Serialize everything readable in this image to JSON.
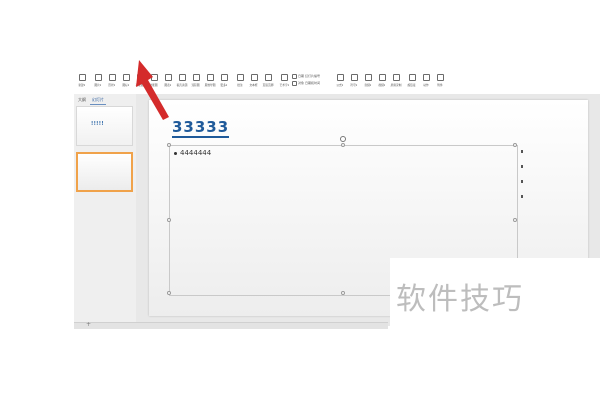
{
  "ribbon": {
    "tools": [
      {
        "name": "tool-1",
        "label": "新建▾"
      },
      {
        "name": "tool-2",
        "label": "图片▾"
      },
      {
        "name": "tool-3",
        "label": "形状▾"
      },
      {
        "name": "tool-4",
        "label": "图标▾"
      },
      {
        "name": "tool-5",
        "label": "功能图"
      },
      {
        "name": "tool-6",
        "label": "智能图"
      },
      {
        "name": "tool-7",
        "label": "图表▾"
      },
      {
        "name": "tool-8",
        "label": "稻壳资源"
      },
      {
        "name": "tool-9",
        "label": "流程图"
      },
      {
        "name": "tool-10",
        "label": "思维导图"
      },
      {
        "name": "tool-11",
        "label": "更多▾"
      },
      {
        "name": "tool-12",
        "label": "批注"
      },
      {
        "name": "tool-13",
        "label": "文本框"
      },
      {
        "name": "tool-14",
        "label": "页眉页脚"
      },
      {
        "name": "tool-15",
        "label": "艺术字▾"
      },
      {
        "name": "tool-16",
        "label": "公式▾"
      },
      {
        "name": "tool-17",
        "label": "符号▾"
      },
      {
        "name": "tool-18",
        "label": "音频▾"
      },
      {
        "name": "tool-19",
        "label": "视频▾"
      },
      {
        "name": "tool-20",
        "label": "屏幕录制"
      },
      {
        "name": "tool-21",
        "label": "超链接"
      },
      {
        "name": "tool-22",
        "label": "动作"
      },
      {
        "name": "tool-23",
        "label": "附件"
      }
    ],
    "wide_tool": {
      "row1": "日期  幻灯片编号",
      "row2": "对象  日期和时间"
    }
  },
  "left_panel": {
    "tabs": [
      "大纲",
      "幻灯片"
    ],
    "thumb1_title": "!!!!!"
  },
  "slide": {
    "title": "33333",
    "bullet": "4444444"
  },
  "watermark": "软件技巧",
  "colors": {
    "accent": "#1f5a9a",
    "selection": "#f0a24a",
    "arrow": "#d42b2b"
  }
}
